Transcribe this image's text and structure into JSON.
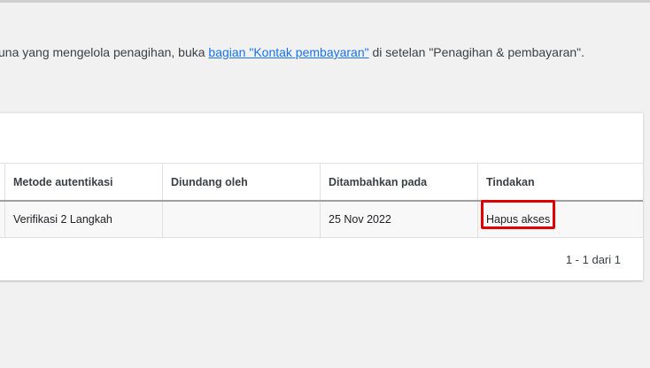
{
  "info": {
    "prefix": "una yang mengelola penagihan, buka ",
    "link": "bagian \"Kontak pembayaran\"",
    "suffix": " di setelan \"Penagihan & pembayaran\"."
  },
  "table": {
    "headers": [
      "Metode autentikasi",
      "Diundang oleh",
      "Ditambahkan pada",
      "Tindakan"
    ],
    "rows": [
      {
        "auth_method": "Verifikasi 2 Langkah",
        "invited_by": "",
        "added_on": "25 Nov 2022",
        "action": "Hapus akses"
      }
    ]
  },
  "pagination": {
    "label": "1 - 1 dari 1"
  },
  "colors": {
    "link": "#1a73e8",
    "highlight": "#e00000"
  }
}
